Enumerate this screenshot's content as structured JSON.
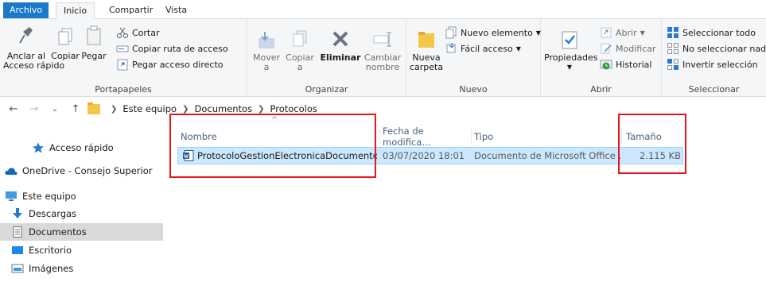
{
  "ribbon_tabs": [
    "Archivo",
    "Inicio",
    "Compartir",
    "Vista"
  ],
  "portapapeles": {
    "pin_label_1": "Anclar al",
    "pin_label_2": "Acceso rápido",
    "copy": "Copiar",
    "paste": "Pegar",
    "cut": "Cortar",
    "copy_path": "Copiar ruta de acceso",
    "paste_shortcut": "Pegar acceso directo",
    "group": "Portapapeles"
  },
  "organizar": {
    "move_1": "Mover",
    "move_2": "a",
    "copy_1": "Copiar",
    "copy_2": "a",
    "delete": "Eliminar",
    "rename_1": "Cambiar",
    "rename_2": "nombre",
    "group": "Organizar"
  },
  "nuevo": {
    "folder_1": "Nueva",
    "folder_2": "carpeta",
    "new_item": "Nuevo elemento",
    "easy_access": "Fácil acceso",
    "group": "Nuevo"
  },
  "abrir": {
    "properties": "Propiedades",
    "open": "Abrir",
    "edit": "Modificar",
    "history": "Historial",
    "group": "Abrir"
  },
  "seleccionar": {
    "all": "Seleccionar todo",
    "none": "No seleccionar nada",
    "invert": "Invertir selección",
    "group": "Seleccionar"
  },
  "address": {
    "crumbs": [
      "Este equipo",
      "Documentos",
      "Protocolos"
    ]
  },
  "nav_pane": {
    "quick_access": "Acceso rápido",
    "onedrive": "OneDrive - Consejo Superior",
    "this_pc": "Este equipo",
    "downloads": "Descargas",
    "documents": "Documentos",
    "desktop": "Escritorio",
    "pictures": "Imágenes"
  },
  "columns": {
    "name": "Nombre",
    "date": "Fecha de modifica...",
    "type": "Tipo",
    "size": "Tamaño"
  },
  "files": [
    {
      "name": "ProtocoloGestionElectronicaDocumentos",
      "date": "03/07/2020 18:01",
      "type": "Documento de Microsoft Office ...",
      "size": "2.115 KB"
    }
  ],
  "colors": {
    "accent": "#1979ca",
    "highlight": "#e8141c",
    "selection": "#cce8ff"
  }
}
